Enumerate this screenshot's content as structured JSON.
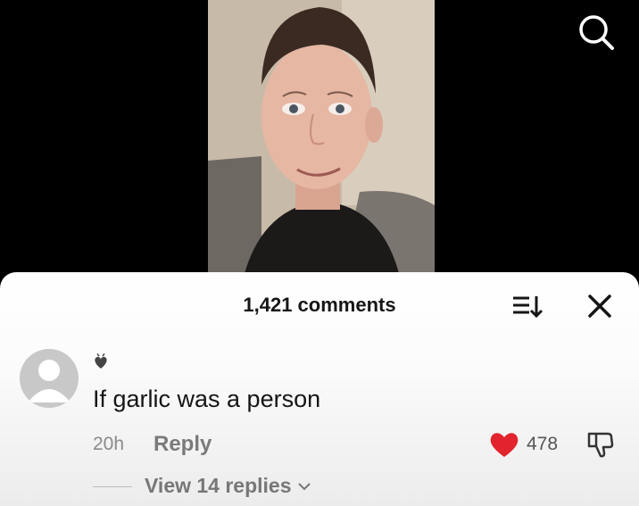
{
  "sheet": {
    "title": "1,421 comments"
  },
  "comment": {
    "text": "If garlic was a person",
    "timestamp": "20h",
    "reply_label": "Reply",
    "like_count": "478",
    "view_replies_label": "View 14 replies"
  },
  "icons": {
    "search": "search-icon",
    "sort": "sort-icon",
    "close": "close-icon",
    "avatar": "default-avatar-icon",
    "username": "heart-emoji-icon",
    "like": "heart-icon",
    "dislike": "thumbs-down-icon",
    "expand": "chevron-down-icon"
  },
  "colors": {
    "like_red": "#e1242d",
    "sheet_bg": "#ffffff",
    "video_bg": "#000000",
    "muted_text": "#8a8a8a"
  }
}
